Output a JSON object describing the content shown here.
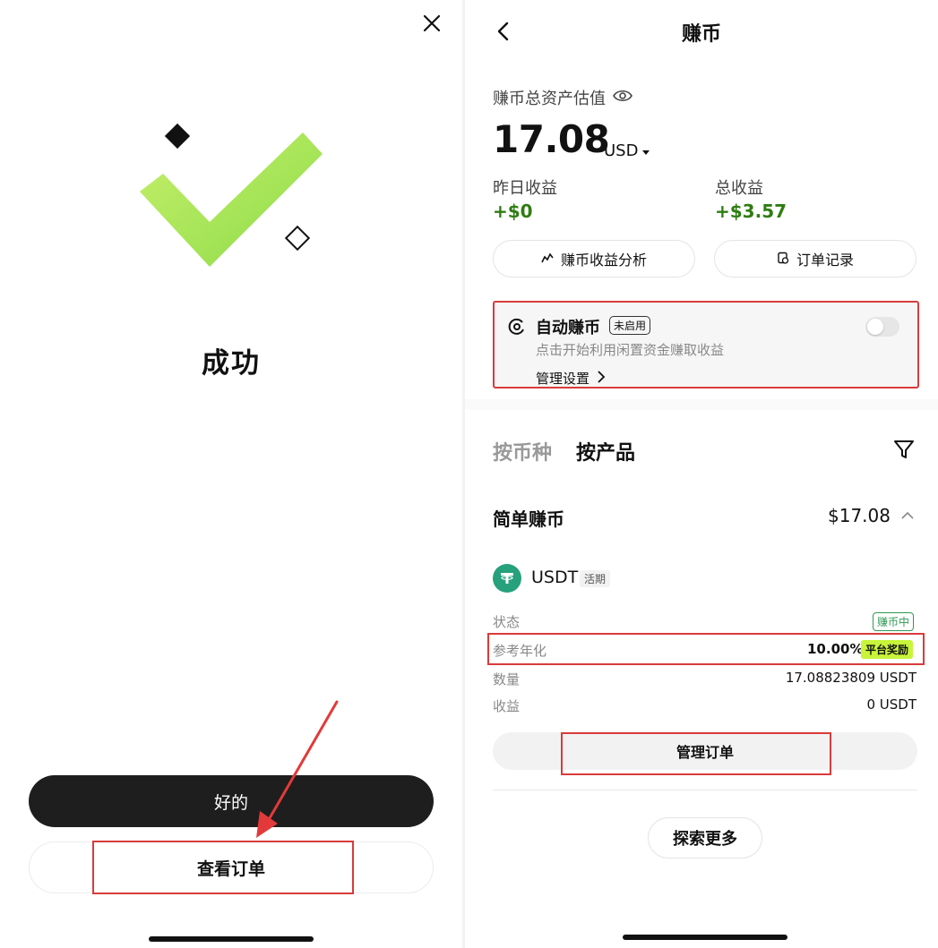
{
  "left": {
    "title": "成功",
    "ok_label": "好的",
    "view_order_label": "查看订单"
  },
  "right": {
    "header": {
      "title": "赚币"
    },
    "assets": {
      "label": "赚币总资产估值",
      "value": "17.08",
      "currency": "USD"
    },
    "yesterday": {
      "label": "昨日收益",
      "value": "+$0"
    },
    "total": {
      "label": "总收益",
      "value": "+$3.57"
    },
    "buttons": {
      "analysis": "赚币收益分析",
      "records": "订单记录"
    },
    "auto": {
      "title": "自动赚币",
      "badge": "未启用",
      "desc": "点击开始利用闲置资金赚取收益",
      "manage": "管理设置",
      "enabled": false
    },
    "tabs": [
      {
        "label": "按币种"
      },
      {
        "label": "按产品"
      }
    ],
    "simple": {
      "title": "简单赚币",
      "value": "$17.08"
    },
    "product": {
      "name": "USDT",
      "tag": "活期",
      "rows": {
        "status_label": "状态",
        "status_value": "赚币中",
        "apr_label": "参考年化",
        "apr_value": "10.00%",
        "apr_badge": "平台奖励",
        "qty_label": "数量",
        "qty_value": "17.08823809 USDT",
        "earn_label": "收益",
        "earn_value": "0 USDT"
      },
      "manage_label": "管理订单"
    },
    "explore_label": "探索更多"
  },
  "colors": {
    "positive": "#2f7d12",
    "accent_lime": "#c8f43a",
    "annotation_red": "#d93b3b",
    "tether_green": "#26a17b"
  }
}
